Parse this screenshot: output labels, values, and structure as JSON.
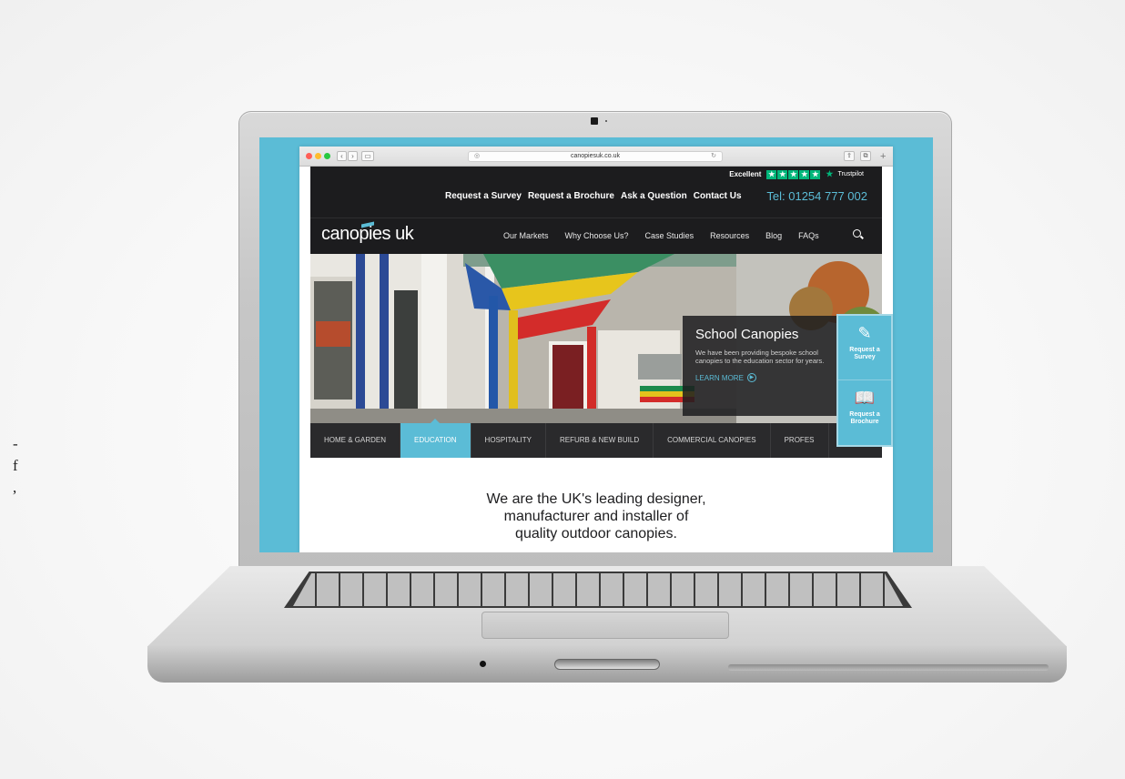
{
  "edge_text": [
    "-",
    "f",
    ","
  ],
  "browser": {
    "url": "canopiesuk.co.uk",
    "back_icon": "chevron-left-icon",
    "forward_icon": "chevron-right-icon"
  },
  "trustpilot": {
    "rating_label": "Excellent",
    "stars": 5,
    "brand": "Trustpilot"
  },
  "top_links": [
    "Request a Survey",
    "Request a Brochure",
    "Ask a Question",
    "Contact Us"
  ],
  "phone": "Tel: 01254 777 002",
  "logo": "canopies uk",
  "nav": [
    "Our Markets",
    "Why Choose Us?",
    "Case Studies",
    "Resources",
    "Blog",
    "FAQs"
  ],
  "hero": {
    "title": "School Canopies",
    "text": "We have been providing bespoke school canopies to the education sector for years.",
    "cta": "LEARN MORE"
  },
  "categories": [
    "HOME & GARDEN",
    "EDUCATION",
    "HOSPITALITY",
    "REFURB & NEW BUILD",
    "COMMERCIAL CANOPIES",
    "PROFES"
  ],
  "active_category": "EDUCATION",
  "side_cta": [
    {
      "icon": "pencil-icon",
      "label": "Request a Survey"
    },
    {
      "icon": "book-icon",
      "label": "Request a Brochure"
    }
  ],
  "intro": [
    "We are the UK's leading designer,",
    "manufacturer and installer of",
    "quality outdoor canopies."
  ],
  "colors": {
    "accent": "#5bbcd6",
    "dark": "#1c1c1e",
    "trustpilot": "#00b67a"
  }
}
